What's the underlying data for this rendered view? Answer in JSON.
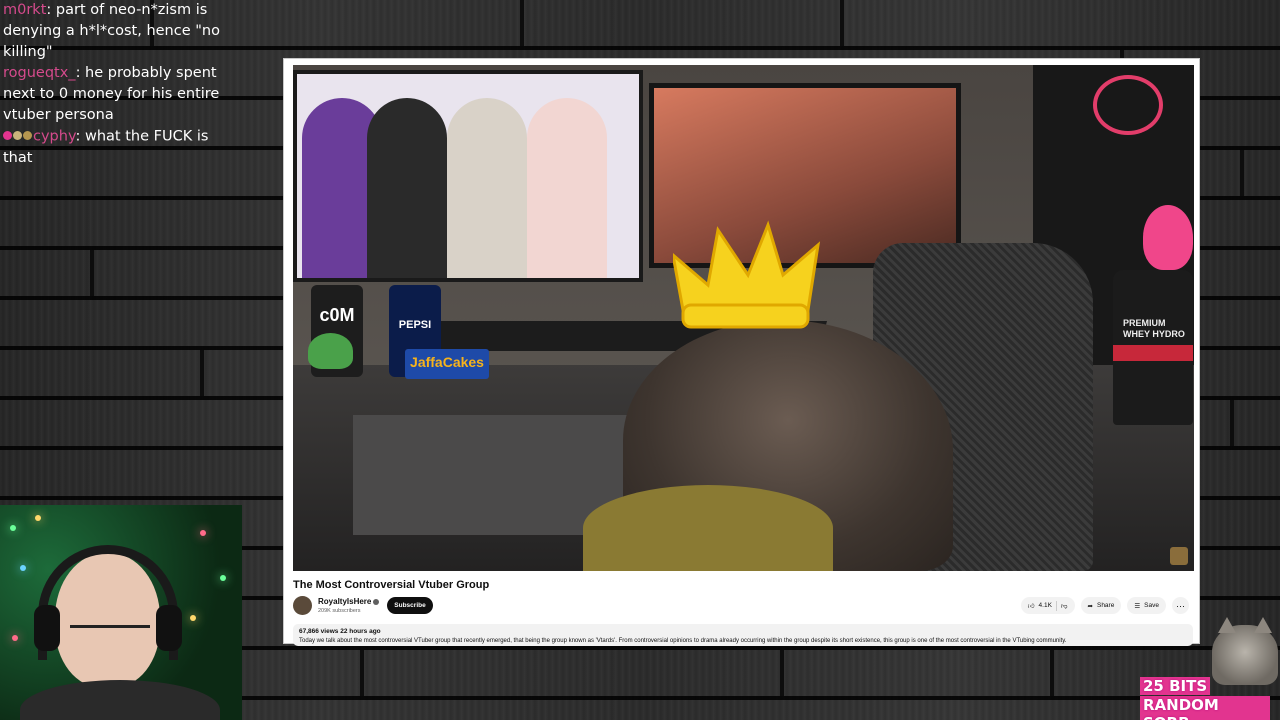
{
  "chat": {
    "messages": [
      {
        "user": "m0rkt",
        "sep": ":",
        "text": " part of neo-n*zism is denying a h*l*cost, hence \"no killing\""
      },
      {
        "user": "rogueqtx_",
        "sep": ":",
        "text": " he probably spent next to 0 money for his entire vtuber persona"
      },
      {
        "user": "cyphy",
        "sep": ":",
        "text": " what the FUCK is that",
        "badge_colors": [
          "#e2348f",
          "#c9b27c",
          "#b5964f"
        ]
      }
    ],
    "username_color": "#d54a8c"
  },
  "video": {
    "props": {
      "can_com": "c0M",
      "can_pepsi": "PEPSI",
      "biscuits": "JaffaCakes",
      "protein": "PREMIUM WHEY HYDRO"
    }
  },
  "youtube": {
    "title": "The Most Controversial Vtuber Group",
    "channel": {
      "name": "RoyaltyIsHere",
      "subscribers": "209K subscribers"
    },
    "subscribe_label": "Subscribe",
    "likes": "4.1K",
    "share_label": "Share",
    "save_label": "Save",
    "more_label": "···",
    "views_line": "67,866 views  22 hours ago",
    "description": "Today we talk about the most controversial VTuber group that recently emerged, that being the group known as 'Vtards'. From controversial opinions to drama already occurring within the group despite its short existence, this group is one of the most controversial in the VTubing community."
  },
  "alert": {
    "amount": "25 BITS",
    "name": "RANDOM SORB",
    "accent": "#e2348f"
  }
}
